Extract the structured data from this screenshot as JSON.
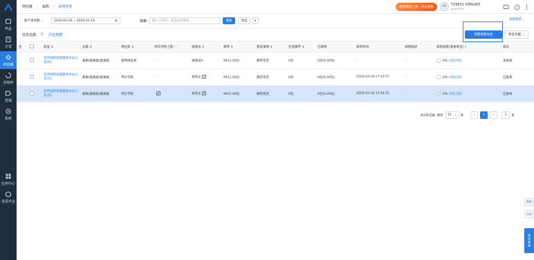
{
  "sidebar": {
    "items": [
      {
        "label": "商品",
        "icon": "product-icon"
      },
      {
        "label": "订单",
        "icon": "order-icon"
      },
      {
        "label": "供应链",
        "icon": "supply-chain-icon"
      },
      {
        "label": "进销存",
        "icon": "inventory-icon"
      },
      {
        "label": "营销",
        "icon": "marketing-icon"
      },
      {
        "label": "系统",
        "icon": "settings-icon"
      }
    ],
    "bottom": [
      {
        "label": "应用中心",
        "icon": "app-center-icon"
      },
      {
        "label": "货源平台",
        "icon": "supply-platform-icon"
      }
    ]
  },
  "breadcrumb": [
    "供应链",
    "采购",
    "采购任务"
  ],
  "promo_label": "有赞精选上线，点击查看",
  "user": {
    "avatar": "AV",
    "name": "T29831 GMGb83",
    "sub": "guestinfo"
  },
  "filter": {
    "date_type": "按下单日期",
    "date_range": "2020-03-18 ~ 2020-03-18",
    "search_label": "搜索:",
    "search_placeholder": "输入订单号、商品名称搜索",
    "search_button": "搜索",
    "export_button": "导出",
    "advanced": "高级筛选"
  },
  "taskbar": {
    "label": "任务总数：",
    "count": "3",
    "history": "历史数据"
  },
  "actions": {
    "new_task": "新建采购任务",
    "more": "更多功能"
  },
  "table": {
    "headers": [
      "主",
      "",
      "商品 ↕",
      "分类 ↕",
      "供应商 ↕",
      "单次可供上限",
      "采购员 ↕",
      "库存 ↕",
      "建议采购 ↕",
      "在途库存 ↕",
      "已采购",
      "发布时间",
      "采购描述",
      "采购进度(基本单位)",
      "状态"
    ],
    "rows": [
      {
        "product": "云环境所有配置改水仪(1包/包)",
        "category": "蔬果/蔬果类/蔬果类",
        "supplier": "团帝供应商",
        "limit": "-",
        "buyer": "采购员A",
        "stock": "9911.00包",
        "suggest": "库存充足",
        "transit": "0包",
        "purchased": "0包(0.00包)",
        "time": "-",
        "desc": "-",
        "progress_pct": "0%",
        "progress_link": "(0包/0包)",
        "status": "未发布",
        "selected": false
      },
      {
        "product": "云环境所有配置改水仪(1包/包)",
        "category": "蔬果/蔬果类/蔬果类",
        "supplier": "平价学校",
        "limit": "-",
        "buyer": "老师士",
        "stock": "9911.00包",
        "suggest": "库存充足",
        "transit": "0包",
        "purchased": "0包(0.00包)",
        "time": "2020-03-18 17:43:57",
        "desc": "-",
        "progress_pct": "0%",
        "progress_link": "(0包/0包)",
        "status": "已发布",
        "selected": false
      },
      {
        "product": "云环境所有配置改水仪(1包/包)",
        "category": "蔬果/蔬果类/蔬果类",
        "supplier": "平价学校",
        "limit": "-",
        "buyer": "老师士",
        "stock": "9911.00包",
        "suggest": "库存充足",
        "transit": "0包",
        "purchased": "0包(0.00包)",
        "time": "2020-03-18 17:44:51",
        "desc": "-",
        "progress_pct": "0%",
        "progress_link": "(0包/2包)",
        "status": "已发布",
        "selected": true
      }
    ]
  },
  "pager": {
    "summary": "共3条记录, 每页",
    "page_size": "10",
    "unit": "条",
    "current": "1",
    "goto": "1",
    "goto_label": "页"
  },
  "float": {
    "btn1": "帮助",
    "btn2": "任务",
    "btn3": "联系客服"
  }
}
